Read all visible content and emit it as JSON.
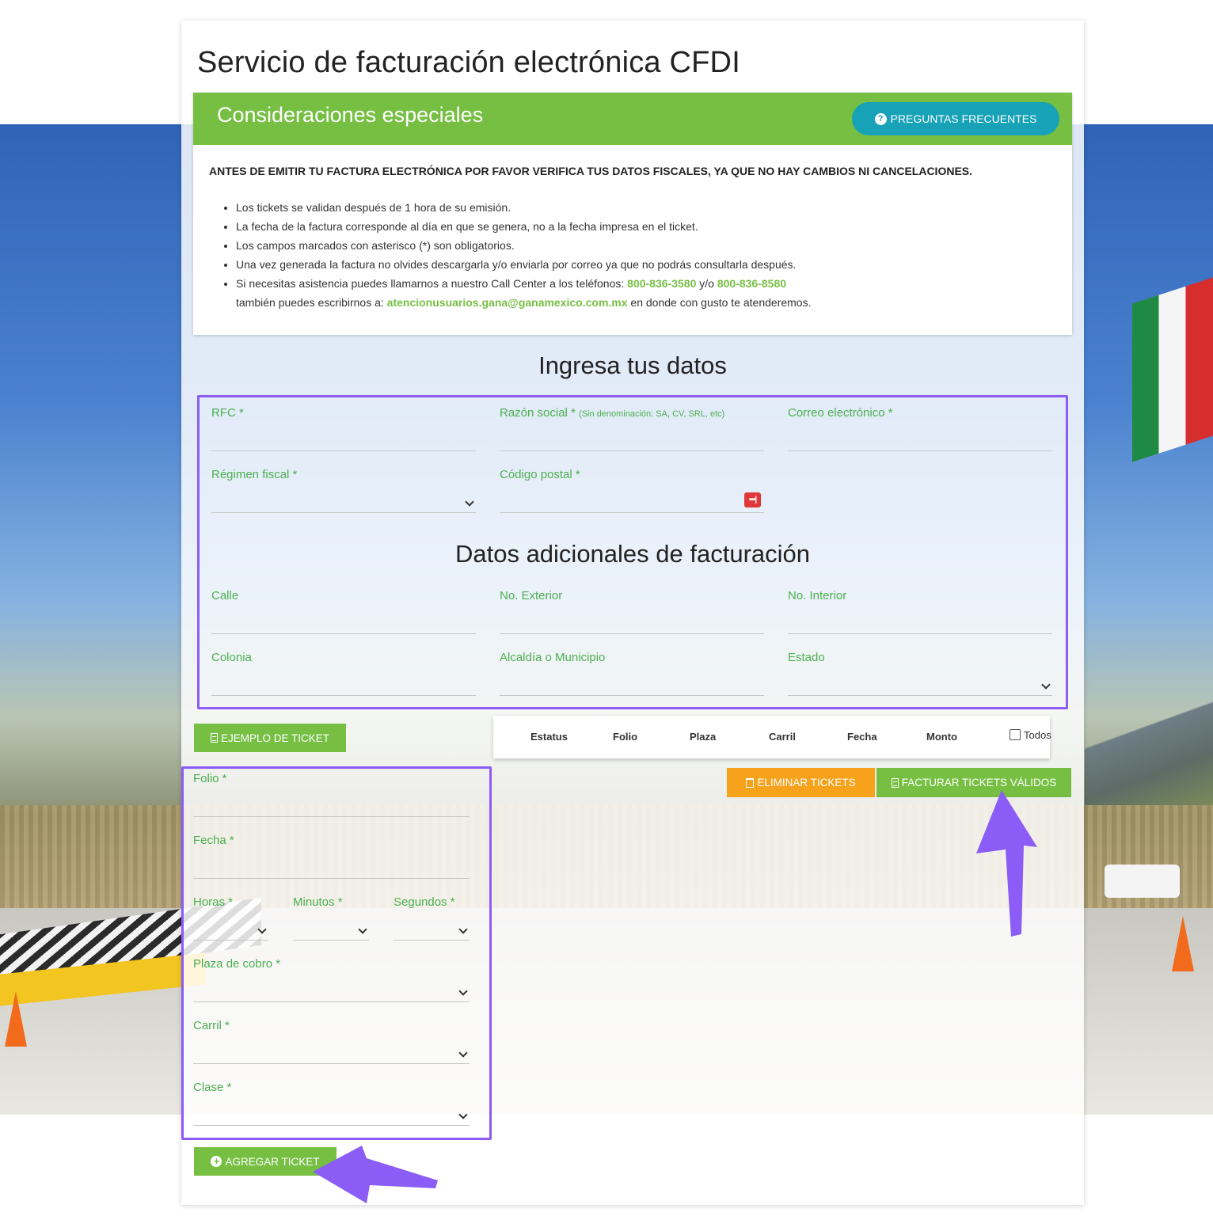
{
  "page_title": "Servicio de facturación electrónica CFDI",
  "considerations": {
    "title": "Consideraciones especiales",
    "faq_button": "PREGUNTAS FRECUENTES",
    "warning": "ANTES DE EMITIR TU FACTURA ELECTRÓNICA POR FAVOR VERIFICA TUS DATOS FISCALES, YA QUE NO HAY CAMBIOS NI CANCELACIONES.",
    "items": [
      "Los tickets se validan después de 1 hora de su emisión.",
      "La fecha de la factura corresponde al día en que se genera, no a la fecha impresa en el ticket.",
      "Los campos marcados con asterisco (*) son obligatorios.",
      "Una vez generada la factura no olvides descargarla y/o enviarla por correo ya que no podrás consultarla después."
    ],
    "contact": {
      "prefix": "Si necesitas asistencia puedes llamarnos a nuestro Call Center a los teléfonos:",
      "phone1": "800-836-3580",
      "or": "y/o",
      "phone2": "800-836-8580",
      "mid": "también puedes escribirnos a:",
      "email": "atencionusuarios.gana@ganamexico.com.mx",
      "suffix": "en donde con gusto te atenderemos."
    }
  },
  "data_section": {
    "title": "Ingresa tus datos",
    "rfc_label": "RFC *",
    "razon_label": "Razón social *",
    "razon_hint": "(Sin denominación: SA, CV, SRL, etc)",
    "correo_label": "Correo electrónico *",
    "regimen_label": "Régimen fiscal *",
    "cp_label": "Código postal *",
    "pw_icon": "•••|"
  },
  "additional": {
    "title": "Datos adicionales de facturación",
    "calle_label": "Calle",
    "exterior_label": "No. Exterior",
    "interior_label": "No. Interior",
    "colonia_label": "Colonia",
    "municipio_label": "Alcaldía o Municipio",
    "estado_label": "Estado"
  },
  "ticket": {
    "example_button": "EJEMPLO DE TICKET",
    "folio_label": "Folio *",
    "fecha_label": "Fecha *",
    "horas_label": "Horas *",
    "minutos_label": "Minutos *",
    "segundos_label": "Segundos *",
    "plaza_label": "Plaza de cobro *",
    "carril_label": "Carril *",
    "clase_label": "Clase *",
    "add_button": "AGREGAR TICKET"
  },
  "table": {
    "columns": [
      "Estatus",
      "Folio",
      "Plaza",
      "Carril",
      "Fecha",
      "Monto"
    ],
    "select_all": "Todos",
    "delete_button": "ELIMINAR TICKETS",
    "invoice_button": "FACTURAR TICKETS VÁLIDOS"
  },
  "colors": {
    "accent_green": "#76bf43",
    "info_teal": "#17a2b8",
    "warning_orange": "#f7a21b",
    "highlight_purple": "#8b5cf6"
  }
}
